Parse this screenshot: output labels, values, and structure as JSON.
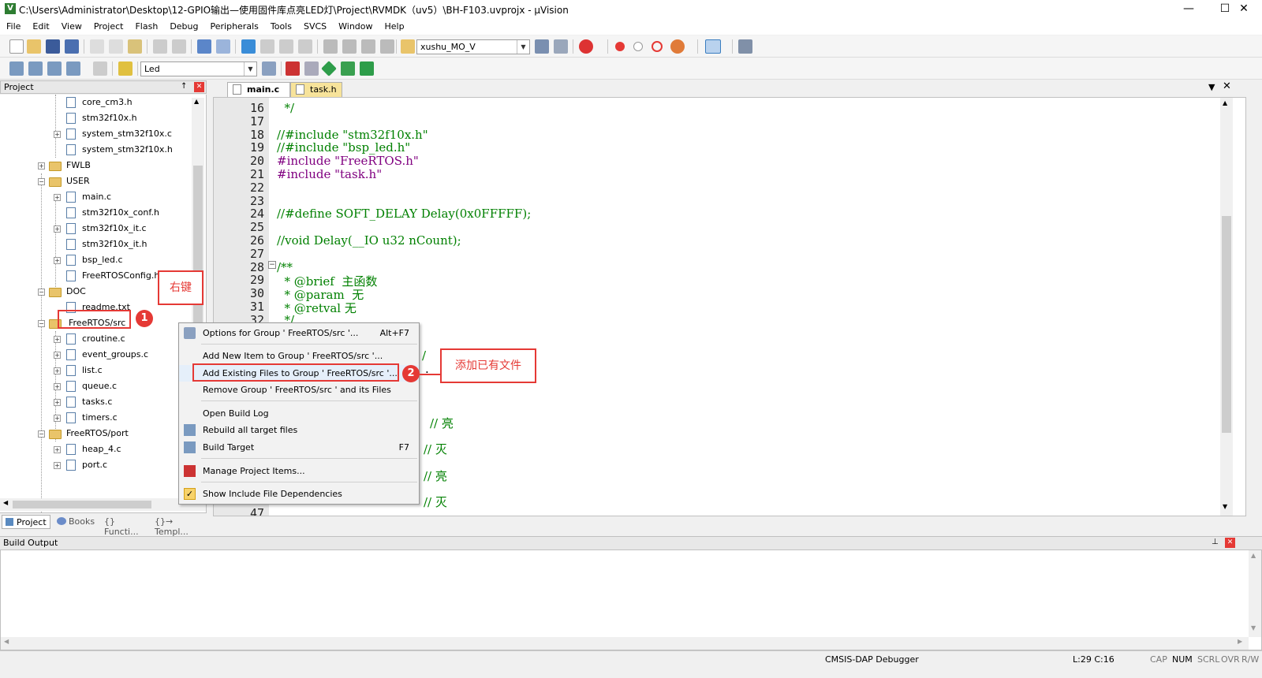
{
  "window": {
    "title": "C:\\Users\\Administrator\\Desktop\\12-GPIO输出—使用固件库点亮LED灯\\Project\\RVMDK（uv5）\\BH-F103.uvprojx - µVision",
    "minimize": "—",
    "maximize": "☐",
    "close": "✕"
  },
  "menubar": [
    "File",
    "Edit",
    "View",
    "Project",
    "Flash",
    "Debug",
    "Peripherals",
    "Tools",
    "SVCS",
    "Window",
    "Help"
  ],
  "toolbar": {
    "find_combo": "xushu_MO_V",
    "target_combo": "Led"
  },
  "project_panel": {
    "title": "Project",
    "pin": "↑",
    "close": "✕",
    "tree": [
      {
        "label": "core_cm3.h",
        "type": "file",
        "expand": ""
      },
      {
        "label": "stm32f10x.h",
        "type": "file",
        "expand": ""
      },
      {
        "label": "system_stm32f10x.c",
        "type": "file",
        "expand": "+"
      },
      {
        "label": "system_stm32f10x.h",
        "type": "file",
        "expand": ""
      },
      {
        "label": "FWLB",
        "type": "folder",
        "expand": "+"
      },
      {
        "label": "USER",
        "type": "folder",
        "expand": "−"
      },
      {
        "label": "main.c",
        "type": "file",
        "expand": "+"
      },
      {
        "label": "stm32f10x_conf.h",
        "type": "file",
        "expand": ""
      },
      {
        "label": "stm32f10x_it.c",
        "type": "file",
        "expand": "+"
      },
      {
        "label": "stm32f10x_it.h",
        "type": "file",
        "expand": ""
      },
      {
        "label": "bsp_led.c",
        "type": "file",
        "expand": "+"
      },
      {
        "label": "FreeRTOSConfig.h",
        "type": "file",
        "expand": ""
      },
      {
        "label": "DOC",
        "type": "folder",
        "expand": "−"
      },
      {
        "label": "readme.txt",
        "type": "file",
        "expand": ""
      },
      {
        "label": "FreeRTOS/src",
        "type": "folder",
        "expand": "−"
      },
      {
        "label": "croutine.c",
        "type": "file",
        "expand": "+"
      },
      {
        "label": "event_groups.c",
        "type": "file",
        "expand": "+"
      },
      {
        "label": "list.c",
        "type": "file",
        "expand": "+"
      },
      {
        "label": "queue.c",
        "type": "file",
        "expand": "+"
      },
      {
        "label": "tasks.c",
        "type": "file",
        "expand": "+"
      },
      {
        "label": "timers.c",
        "type": "file",
        "expand": "+"
      },
      {
        "label": "FreeRTOS/port",
        "type": "folder",
        "expand": "−"
      },
      {
        "label": "heap_4.c",
        "type": "file",
        "expand": "+"
      },
      {
        "label": "port.c",
        "type": "file",
        "expand": "+"
      }
    ],
    "bottom_tabs": [
      "Project",
      "Books",
      "{} Functi...",
      "{}→ Templ..."
    ]
  },
  "editor": {
    "tabs": [
      {
        "label": "main.c",
        "active": true
      },
      {
        "label": "task.h",
        "active": false
      }
    ],
    "lines": [
      {
        "n": "16",
        "text": "  */",
        "cls": "c-cm"
      },
      {
        "n": "17",
        "text": "",
        "cls": ""
      },
      {
        "n": "18",
        "text": "//#include \"stm32f10x.h\"",
        "cls": "c-cm"
      },
      {
        "n": "19",
        "text": "//#include \"bsp_led.h\"",
        "cls": "c-cm"
      },
      {
        "n": "20",
        "text": "#include \"FreeRTOS.h\"",
        "cls": "c-pp"
      },
      {
        "n": "21",
        "text": "#include \"task.h\"",
        "cls": "c-pp"
      },
      {
        "n": "22",
        "text": "",
        "cls": ""
      },
      {
        "n": "23",
        "text": "",
        "cls": ""
      },
      {
        "n": "24",
        "text": "//#define SOFT_DELAY Delay(0x0FFFFF);",
        "cls": "c-cm"
      },
      {
        "n": "25",
        "text": "",
        "cls": ""
      },
      {
        "n": "26",
        "text": "//void Delay(__IO u32 nCount);",
        "cls": "c-cm"
      },
      {
        "n": "27",
        "text": "",
        "cls": ""
      },
      {
        "n": "28",
        "text": "/**",
        "cls": "c-cm"
      },
      {
        "n": "29",
        "text": "  * @brief  主函数",
        "cls": "c-cm"
      },
      {
        "n": "30",
        "text": "  * @param  无",
        "cls": "c-cm"
      },
      {
        "n": "31",
        "text": "  * @retval 无",
        "cls": "c-cm"
      },
      {
        "n": "32",
        "text": "  */",
        "cls": "c-cm"
      }
    ],
    "partial_comments": [
      "/",
      ".",
      "// 亮",
      "// 灭",
      "// 亮",
      "// 灭"
    ],
    "partial_line": "47"
  },
  "context_menu": {
    "items": [
      {
        "label": "Options for Group ' FreeRTOS/src '...",
        "shortcut": "Alt+F7",
        "icon": "options-icon"
      },
      {
        "label": "Add New  Item to Group ' FreeRTOS/src '...",
        "shortcut": "",
        "icon": ""
      },
      {
        "label": "Add Existing Files to Group ' FreeRTOS/src '...",
        "shortcut": "",
        "icon": ""
      },
      {
        "label": "Remove Group ' FreeRTOS/src ' and its Files",
        "shortcut": "",
        "icon": ""
      },
      {
        "label": "Open Build Log",
        "shortcut": "",
        "icon": ""
      },
      {
        "label": "Rebuild all target files",
        "shortcut": "",
        "icon": "rebuild-icon"
      },
      {
        "label": "Build Target",
        "shortcut": "F7",
        "icon": "build-icon"
      },
      {
        "label": "Manage Project Items...",
        "shortcut": "",
        "icon": "manage-items-icon"
      },
      {
        "label": "Show Include File Dependencies",
        "shortcut": "",
        "icon": "checkmark-icon"
      }
    ]
  },
  "annotations": {
    "badge1": "1",
    "badge2": "2",
    "callout1": "右键",
    "callout2": "添加已有文件"
  },
  "build_output": {
    "title": "Build Output"
  },
  "statusbar": {
    "debugger": "CMSIS-DAP Debugger",
    "position": "L:29 C:16",
    "cap": "CAP",
    "num": "NUM",
    "scrl": "SCRL",
    "ovr": "OVR",
    "rw": "R/W"
  },
  "colors": {
    "annotation_red": "#e53935",
    "comment_green": "#008000",
    "preprocessor_purple": "#800080"
  }
}
